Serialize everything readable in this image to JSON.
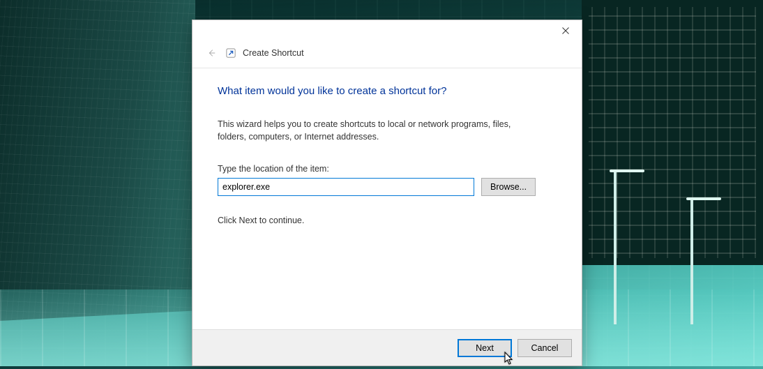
{
  "dialog": {
    "window_title": "Create Shortcut",
    "heading": "What item would you like to create a shortcut for?",
    "description": "This wizard helps you to create shortcuts to local or network programs, files, folders, computers, or Internet addresses.",
    "location_label": "Type the location of the item:",
    "location_value": "explorer.exe",
    "browse_label": "Browse...",
    "continue_text": "Click Next to continue.",
    "next_label": "Next",
    "cancel_label": "Cancel"
  },
  "icons": {
    "close": "close-icon",
    "back": "back-arrow-icon",
    "shortcut": "shortcut-arrow-icon"
  }
}
